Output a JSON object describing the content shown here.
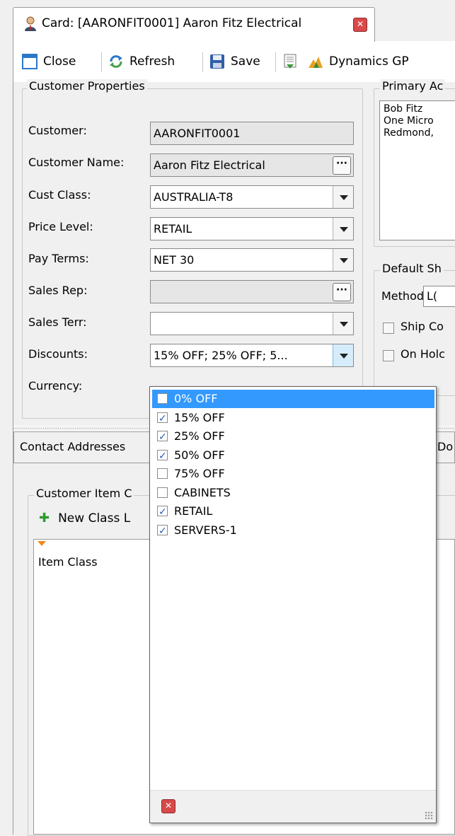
{
  "window": {
    "tab_title": "Card: [AARONFIT0001] Aaron Fitz Electrical",
    "user_icon": "user-icon",
    "close_icon": "close-icon"
  },
  "toolbar": {
    "close_label": "Close",
    "refresh_label": "Refresh",
    "save_label": "Save",
    "dynamics_label": "Dynamics GP"
  },
  "customer_properties": {
    "group_label": "Customer Properties",
    "customer_label": "Customer:",
    "customer_value": "AARONFIT0001",
    "customer_name_label": "Customer Name:",
    "customer_name_value": "Aaron Fitz Electrical",
    "cust_class_label": "Cust Class:",
    "cust_class_value": "AUSTRALIA-T8",
    "price_level_label": "Price Level:",
    "price_level_value": "RETAIL",
    "pay_terms_label": "Pay Terms:",
    "pay_terms_value": "NET 30",
    "sales_rep_label": "Sales Rep:",
    "sales_rep_value": "",
    "sales_terr_label": "Sales Terr:",
    "sales_terr_value": "",
    "discounts_label": "Discounts:",
    "discounts_value": "15% OFF; 25% OFF; 5...",
    "currency_label": "Currency:"
  },
  "primary_address": {
    "group_label": "Primary Ac",
    "lines": [
      "Bob Fitz",
      "One Micro",
      "Redmond,"
    ]
  },
  "default_shipping": {
    "group_label": "Default Sh",
    "method_label": "Method",
    "method_value": "L(",
    "ship_complete_label": "Ship Co",
    "on_hold_label": "On Holc"
  },
  "lower_tabs": {
    "tab1": "Contact Addresses",
    "tab2": "Do"
  },
  "customer_item_classes": {
    "group_label": "Customer Item C",
    "new_class_label": "New Class L",
    "column_item_class": "Item Class"
  },
  "discount_options": [
    {
      "label": "0% OFF",
      "checked": false,
      "highlighted": true
    },
    {
      "label": "15% OFF",
      "checked": true,
      "highlighted": false
    },
    {
      "label": "25% OFF",
      "checked": true,
      "highlighted": false
    },
    {
      "label": "50% OFF",
      "checked": true,
      "highlighted": false
    },
    {
      "label": "75% OFF",
      "checked": false,
      "highlighted": false
    },
    {
      "label": "CABINETS",
      "checked": false,
      "highlighted": false
    },
    {
      "label": "RETAIL",
      "checked": true,
      "highlighted": false
    },
    {
      "label": "SERVERS-1",
      "checked": true,
      "highlighted": false
    }
  ],
  "colors": {
    "highlight": "#3399ff",
    "close_red": "#d84a4a",
    "add_green": "#2e9b2e"
  }
}
